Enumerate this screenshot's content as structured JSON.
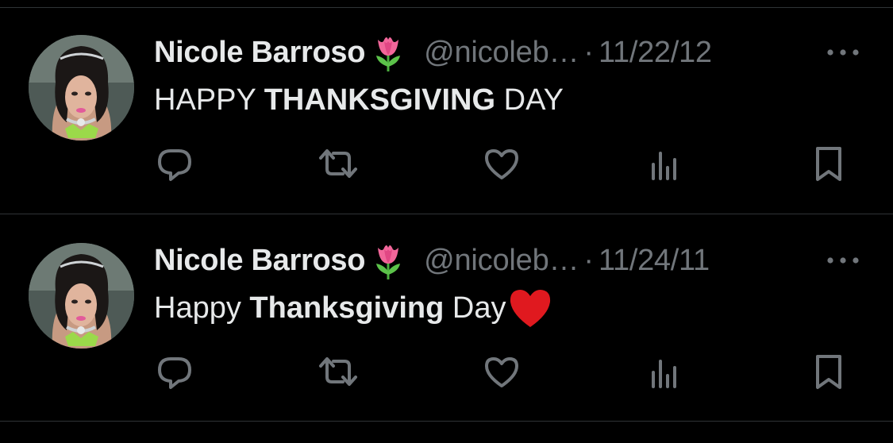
{
  "tweets": [
    {
      "author_name": "Nicole Barroso",
      "author_emoji": "tulip-emoji",
      "handle": "@nicoleb…",
      "separator": "·",
      "date": "11/22/12",
      "text_before": "HAPPY ",
      "text_bold": "THANKSGIVING",
      "text_after": " DAY",
      "trailing_emoji": ""
    },
    {
      "author_name": "Nicole Barroso",
      "author_emoji": "tulip-emoji",
      "handle": "@nicoleb…",
      "separator": "·",
      "date": "11/24/11",
      "text_before": "Happy ",
      "text_bold": "Thanksgiving",
      "text_after": " Day",
      "trailing_emoji": "red-heart-emoji"
    }
  ],
  "actions": [
    "reply-icon",
    "retweet-icon",
    "like-icon",
    "views-icon",
    "bookmark-icon"
  ],
  "colors": {
    "background": "#000000",
    "primary_text": "#e7e9ea",
    "secondary_text": "#71767b",
    "divider": "#2f3336",
    "heart": "#e0191f",
    "tulip": "#f2669a"
  }
}
